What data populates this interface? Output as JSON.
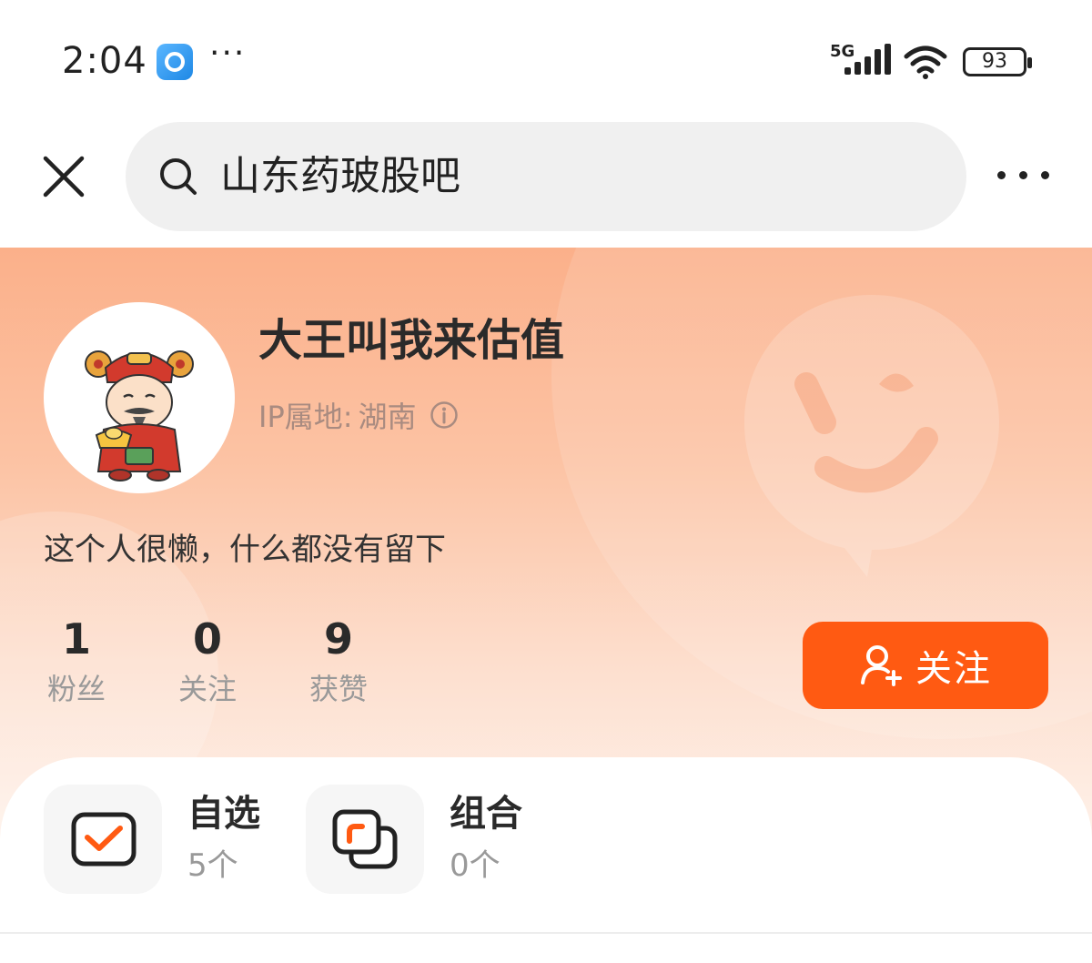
{
  "status_bar": {
    "time": "2:04",
    "dots": "···",
    "network": "5G",
    "battery": "93"
  },
  "header": {
    "search_text": "山东药玻股吧"
  },
  "profile": {
    "name": "大王叫我来估值",
    "ip_label": "IP属地:",
    "ip_value": "湖南",
    "bio": "这个人很懒，什么都没有留下",
    "stats": [
      {
        "value": "1",
        "label": "粉丝"
      },
      {
        "value": "0",
        "label": "关注"
      },
      {
        "value": "9",
        "label": "获赞"
      }
    ],
    "follow_label": "关注"
  },
  "shortcuts": [
    {
      "title": "自选",
      "count": "5个",
      "icon": "checkbox-icon"
    },
    {
      "title": "组合",
      "count": "0个",
      "icon": "combination-icon"
    }
  ],
  "colors": {
    "accent": "#ff5a12",
    "gradient_top": "#fbb08a"
  }
}
